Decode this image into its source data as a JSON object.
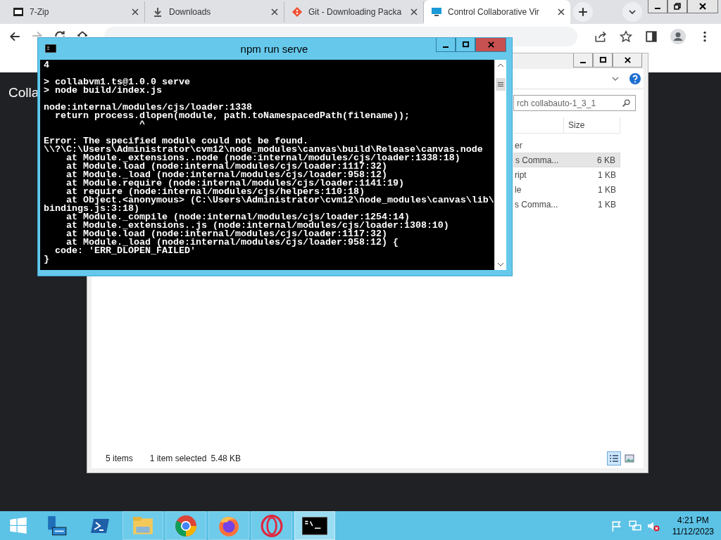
{
  "browser": {
    "tabs": [
      {
        "title": "7-Zip",
        "kind": "sevenzip",
        "selected": false
      },
      {
        "title": "Downloads",
        "kind": "download",
        "selected": false
      },
      {
        "title": "Git - Downloading Packa",
        "kind": "git",
        "selected": false
      },
      {
        "title": "Control Collaborative Vir",
        "kind": "monitor",
        "selected": true
      }
    ],
    "nav": [
      {
        "kind": "back",
        "disabled": false
      },
      {
        "kind": "forward",
        "disabled": true
      },
      {
        "kind": "reload",
        "disabled": false
      },
      {
        "kind": "home",
        "disabled": false
      }
    ],
    "page": {
      "heading": "Colla"
    }
  },
  "explorer": {
    "search_placeholder": "rch collabauto-1_3_1",
    "size_column": "Size",
    "rows": [
      {
        "name": "er",
        "selected": false
      },
      {
        "name": "s Comma...",
        "size": "6 KB",
        "selected": true
      },
      {
        "name": "ript",
        "size": "1 KB",
        "selected": false
      },
      {
        "name": "le",
        "size": "1 KB",
        "selected": false
      },
      {
        "name": "s Comma...",
        "size": "1 KB",
        "selected": false
      }
    ],
    "status": {
      "count": "5 items",
      "selection": "1 item selected",
      "size": "5.48 KB"
    },
    "views": [
      {
        "kind": "details",
        "selected": true
      },
      {
        "kind": "tiles",
        "selected": false
      }
    ]
  },
  "console": {
    "title": "npm run serve",
    "lines": [
      {
        "text": "4"
      },
      {
        "text": "> collabvm1.ts@1.0.0 serve",
        "blank_before": true
      },
      {
        "text": "> node build/index.js"
      },
      {
        "text": "node:internal/modules/cjs/loader:1338",
        "blank_before": true
      },
      {
        "text": "  return process.dlopen(module, path.toNamespacedPath(filename));"
      },
      {
        "text": "                 ^"
      },
      {
        "text": "Error: The specified module could not be found.",
        "blank_before": true
      },
      {
        "text": "\\\\?\\C:\\Users\\Administrator\\cvm12\\node_modules\\canvas\\build\\Release\\canvas.node"
      },
      {
        "text": "    at Module._extensions..node (node:internal/modules/cjs/loader:1338:18)"
      },
      {
        "text": "    at Module.load (node:internal/modules/cjs/loader:1117:32)"
      },
      {
        "text": "    at Module._load (node:internal/modules/cjs/loader:958:12)"
      },
      {
        "text": "    at Module.require (node:internal/modules/cjs/loader:1141:19)"
      },
      {
        "text": "    at require (node:internal/modules/cjs/helpers:110:18)"
      },
      {
        "text": "    at Object.<anonymous> (C:\\Users\\Administrator\\cvm12\\node_modules\\canvas\\lib\\"
      },
      {
        "text": "bindings.js:3:18)"
      },
      {
        "text": "    at Module._compile (node:internal/modules/cjs/loader:1254:14)"
      },
      {
        "text": "    at Module._extensions..js (node:internal/modules/cjs/loader:1308:10)"
      },
      {
        "text": "    at Module.load (node:internal/modules/cjs/loader:1117:32)"
      },
      {
        "text": "    at Module._load (node:internal/modules/cjs/loader:958:12) {"
      },
      {
        "text": "  code: 'ERR_DLOPEN_FAILED'"
      },
      {
        "text": "}"
      }
    ]
  },
  "taskbar": {
    "apps": [
      {
        "kind": "server-manager",
        "running": false,
        "active": false
      },
      {
        "kind": "powershell",
        "running": false,
        "active": false
      },
      {
        "kind": "explorer",
        "running": true,
        "active": false
      },
      {
        "kind": "chrome",
        "running": true,
        "active": false
      },
      {
        "kind": "firefox",
        "running": true,
        "active": false
      },
      {
        "kind": "opera",
        "running": true,
        "active": false
      },
      {
        "kind": "cmd",
        "running": true,
        "active": true
      }
    ],
    "clock": {
      "time": "4:21 PM",
      "date": "11/12/2023"
    }
  }
}
